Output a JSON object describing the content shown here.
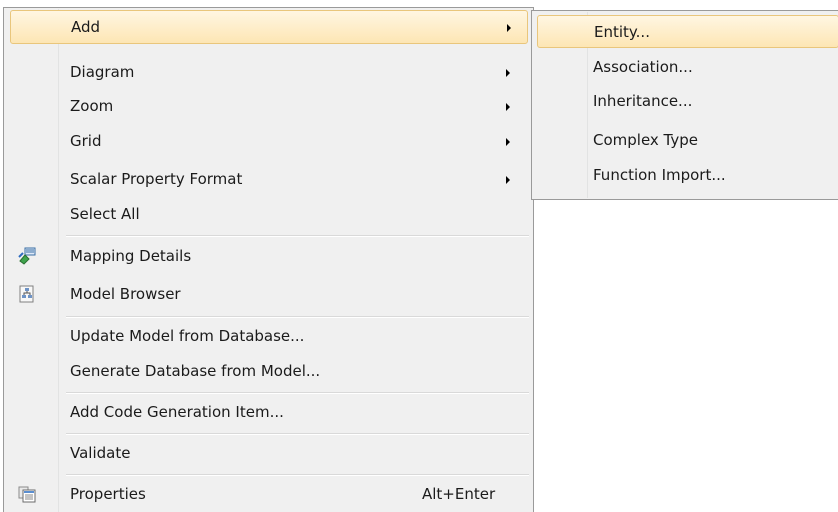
{
  "context_menu": {
    "items": [
      {
        "label": "Add",
        "has_submenu": true,
        "highlighted": true
      },
      {
        "label": "Diagram",
        "has_submenu": true
      },
      {
        "label": "Zoom",
        "has_submenu": true
      },
      {
        "label": "Grid",
        "has_submenu": true
      },
      {
        "label": "Scalar Property Format",
        "has_submenu": true
      },
      {
        "label": "Select All"
      },
      {
        "label": "Mapping Details",
        "icon": "mapping-details-icon"
      },
      {
        "label": "Model Browser",
        "icon": "model-browser-icon"
      },
      {
        "label": "Update Model from Database..."
      },
      {
        "label": "Generate Database from Model..."
      },
      {
        "label": "Add Code Generation Item..."
      },
      {
        "label": "Validate"
      },
      {
        "label": "Properties",
        "icon": "properties-icon",
        "shortcut": "Alt+Enter"
      }
    ]
  },
  "add_submenu": {
    "items": [
      {
        "label": "Entity...",
        "highlighted": true
      },
      {
        "label": "Association..."
      },
      {
        "label": "Inheritance..."
      },
      {
        "label": "Complex Type"
      },
      {
        "label": "Function Import..."
      }
    ]
  },
  "colors": {
    "menu_background": "#f0f0f0",
    "menu_border": "#9a9a9a",
    "highlight_top": "#fff6e2",
    "highlight_bottom": "#fde6b4",
    "highlight_border": "#e9c67c"
  }
}
